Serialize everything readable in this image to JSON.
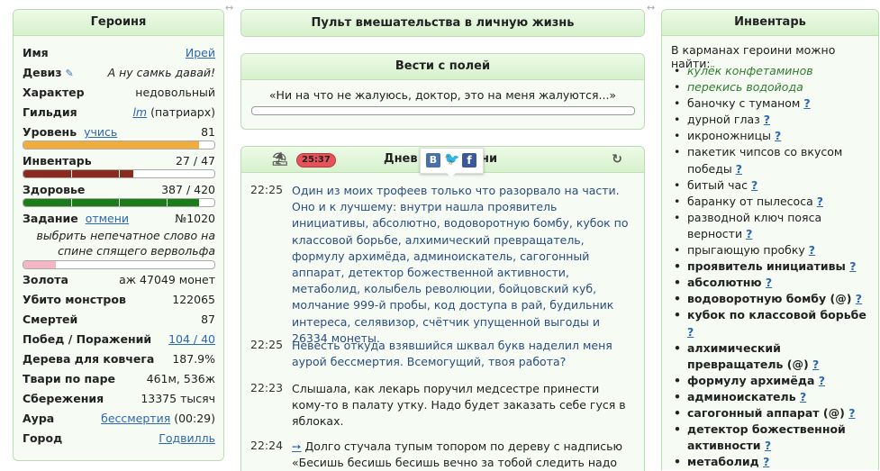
{
  "hero": {
    "title": "Героиня",
    "stats": {
      "name_label": "Имя",
      "name_value": "Ирей",
      "motto_label": "Девиз",
      "motto_value": "А ну самкь давай!",
      "character_label": "Характер",
      "character_value": "недовольный",
      "guild_label": "Гильдия",
      "guild_value": "lm",
      "guild_rank": "(патриарх)",
      "level_label": "Уровень",
      "level_link": "учись",
      "level_value": "81",
      "level_progress": 0.92,
      "inventory_label": "Инвентарь",
      "inventory_value": "27 / 47",
      "inventory_fill": 0.574,
      "health_label": "Здоровье",
      "health_value": "387 / 420",
      "health_fill": 0.921,
      "quest_label": "Задание",
      "quest_link": "отмени",
      "quest_number": "№1020",
      "quest_text": "выбрить непечатное слово на спине спящего вервольфа",
      "quest_progress": 0.17,
      "gold_label": "Золота",
      "gold_value": "аж 47049 монет",
      "monsters_label": "Убито монстров",
      "monsters_value": "122065",
      "deaths_label": "Смертей",
      "deaths_value": "87",
      "wins_label": "Побед / Поражений",
      "wins_value": "104 / 40",
      "trees_label": "Дерева для ковчега",
      "trees_value": "187.9%",
      "pairs_label": "Твари по паре",
      "pairs_value": "461м, 536ж",
      "savings_label": "Сбережения",
      "savings_value": "13375 тысяч",
      "aura_label": "Аура",
      "aura_link": "бессмертия",
      "aura_time": "(00:29)",
      "town_label": "Город",
      "town_value": "Годвилль"
    }
  },
  "pult": {
    "title": "Пульт вмешательства в личную жизнь"
  },
  "news": {
    "title": "Вести с полей",
    "text": "«Ни на что не жалуюсь, доктор, это на меня жалуются...»",
    "progress": 0.0
  },
  "diary": {
    "title_start": "Днев",
    "title_end": "ни",
    "timer": "25:37",
    "entries": [
      {
        "time": "22:25",
        "text": "Один из моих трофеев только что разорвало на части. Оно и к лучшему: внутри нашла проявитель инициативы, абсолютно, водоворотную бомбу, кубок по классовой борьбе, алхимический превращатель, формулу архимёда, админоискатель, сагогонный аппарат, детектор божественной активности, метаболид, колыбель революции, бойцовский куб, молчание 999-й пробы, код доступа в рай, будильник интереса, селявизор, счётчик упущенной выгоды и 26334 монеты."
      },
      {
        "time": "22:25",
        "text": "Невесть откуда взявшийся шквал букв наделил меня аурой бессмертия. Всемогущий, твоя работа?"
      },
      {
        "time": "22:23",
        "text": "Слышала, как лекарь поручил медсестре принести кому-то в палату утку. Надо будет заказать себе гуся в яблоках."
      },
      {
        "time": "22:24",
        "marker": "➙",
        "text": "Долго стучала тупым топором по дереву с надписью «Бесишь бесишь бесишь вечно за тобой следить надо ну"
      }
    ]
  },
  "inventory": {
    "title": "Инвентарь",
    "intro": "В карманах героини можно найти:",
    "items": [
      {
        "name": "кулёк конфетаминов",
        "style": "green",
        "q": ""
      },
      {
        "name": "перекись водойода",
        "style": "green",
        "q": ""
      },
      {
        "name": "баночку с туманом",
        "style": "",
        "q": "?"
      },
      {
        "name": "дурной глаз",
        "style": "",
        "q": "?"
      },
      {
        "name": "икроножницы",
        "style": "",
        "q": "?"
      },
      {
        "name": "пакетик чипсов со вкусом победы",
        "style": "",
        "q": "?"
      },
      {
        "name": "битый час",
        "style": "",
        "q": "?"
      },
      {
        "name": "баранку от пылесоса",
        "style": "",
        "q": "?"
      },
      {
        "name": "разводной ключ пояса верности",
        "style": "",
        "q": "?"
      },
      {
        "name": "прыгающую пробку",
        "style": "",
        "q": "?"
      },
      {
        "name": "проявитель инициативы",
        "style": "active",
        "q": "?"
      },
      {
        "name": "абсолютню",
        "style": "active",
        "q": "?"
      },
      {
        "name": "водоворотную бомбу (@)",
        "style": "active",
        "q": "?"
      },
      {
        "name": "кубок по классовой борьбе",
        "style": "active",
        "q": "?"
      },
      {
        "name": "алхимический превращатель (@)",
        "style": "active",
        "q": "?"
      },
      {
        "name": "формулу архимёда",
        "style": "active",
        "q": "?"
      },
      {
        "name": "админоискатель",
        "style": "active",
        "q": "?"
      },
      {
        "name": "сагогонный аппарат (@)",
        "style": "active",
        "q": "?"
      },
      {
        "name": "детектор божественной активности",
        "style": "active",
        "q": "?"
      },
      {
        "name": "метаболид",
        "style": "active",
        "q": "?"
      }
    ]
  },
  "colors": {
    "panel_border": "#b9dcb2",
    "header_bg": "#d6f1cc",
    "level_bar": "#f0ad3c",
    "inventory_bar": "#8b2b1e",
    "health_bar": "#1a7d1a",
    "quest_bar": "#f4b6c2",
    "link": "#2b67b3",
    "timer_badge": "#e5535a"
  }
}
